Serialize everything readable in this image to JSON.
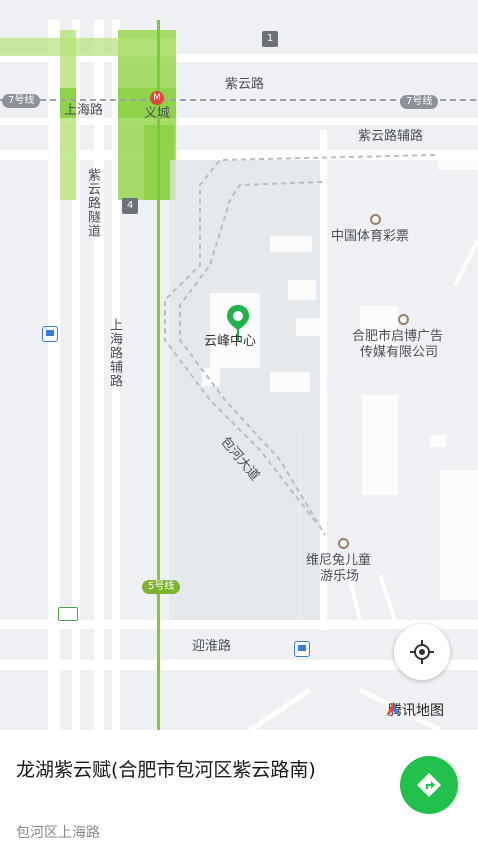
{
  "map": {
    "metro_line_7": "7号线",
    "metro_line_5": "5号线",
    "streets": {
      "ziyun_road": "紫云路",
      "ziyun_aux_road": "紫云路辅路",
      "ziyun_tunnel": "紫云路隧道",
      "shanghai_road": "上海路",
      "shanghai_aux_road": "上海路辅路",
      "baohe_avenue": "包河大道",
      "yinghuai_road": "迎淮路"
    },
    "stations": {
      "yicheng": "义城"
    },
    "exits": {
      "exit1": "1",
      "exit4": "4"
    },
    "pois": {
      "lottery": "中国体育彩票",
      "qibo_line1": "合肥市启博广告",
      "qibo_line2": "传媒有限公司",
      "winnie_line1": "维尼兔儿童",
      "winnie_line2": "游乐场",
      "yunfeng": "云峰中心"
    },
    "icons": {
      "pin": "location-pin-icon",
      "locate": "locate-crosshair-icon",
      "compass": "tencent-map-logo-icon",
      "navigate": "navigate-arrow-icon",
      "bus": "bus-stop-icon"
    },
    "colors": {
      "metro_green": "#8fd34a",
      "pin_green": "#21b24b",
      "nav_green": "#21c14c"
    }
  },
  "brand": "腾讯地图",
  "place": {
    "title": "龙湖紫云赋(合肥市包河区紫云路南)",
    "address": "包河区上海路"
  }
}
